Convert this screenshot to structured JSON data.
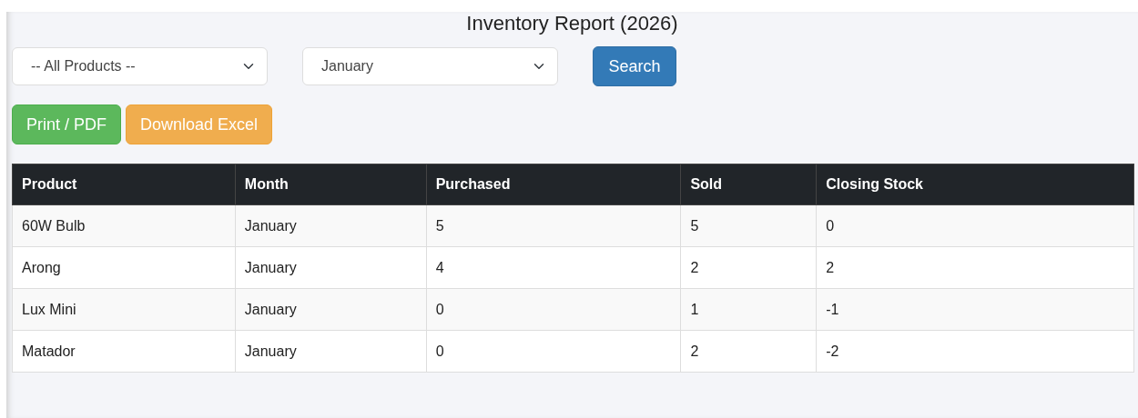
{
  "title": "Inventory Report (2026)",
  "filters": [
    {
      "value": "-- All Products --"
    },
    {
      "value": "January"
    }
  ],
  "search_button": "Search",
  "actions": [
    {
      "label": "Print / PDF",
      "kind": "success"
    },
    {
      "label": "Download Excel",
      "kind": "warning"
    }
  ],
  "table": {
    "columns": [
      "Product",
      "Month",
      "Purchased",
      "Sold",
      "Closing Stock"
    ],
    "rows": [
      [
        "60W Bulb",
        "January",
        "5",
        "5",
        "0"
      ],
      [
        "Arong",
        "January",
        "4",
        "2",
        "2"
      ],
      [
        "Lux Mini",
        "January",
        "0",
        "1",
        "-1"
      ],
      [
        "Matador",
        "January",
        "0",
        "2",
        "-2"
      ]
    ]
  }
}
